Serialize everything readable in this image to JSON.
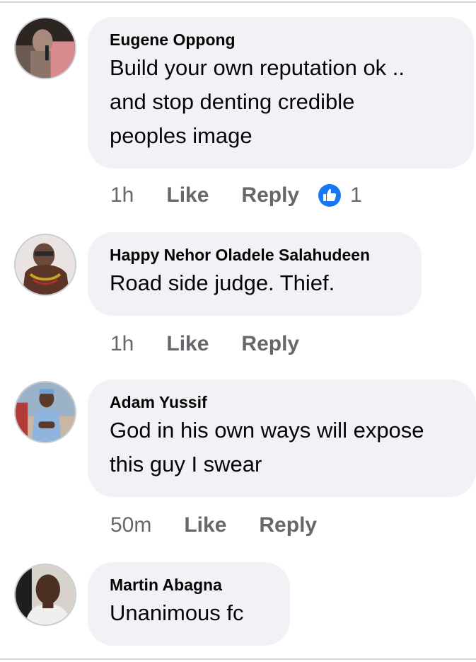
{
  "comments": [
    {
      "author": "Eugene Oppong",
      "lines": [
        "Build your own reputation ok ..",
        "and stop denting credible",
        "peoples image"
      ],
      "time": "1h",
      "like_label": "Like",
      "reply_label": "Reply",
      "reaction_count": "1",
      "reaction_icon": "thumbs-up-icon",
      "reaction_color": "#1877f2"
    },
    {
      "author": "Happy Nehor Oladele Salahudeen",
      "lines": [
        "Road side judge. Thief."
      ],
      "time": "1h",
      "like_label": "Like",
      "reply_label": "Reply"
    },
    {
      "author": "Adam Yussif",
      "lines": [
        "God in his own ways will expose",
        "this guy I swear"
      ],
      "time": "50m",
      "like_label": "Like",
      "reply_label": "Reply"
    },
    {
      "author": "Martin Abagna",
      "lines": [
        "Unanimous fc"
      ]
    }
  ],
  "colors": {
    "bubble_bg": "#f0f2f5",
    "meta_text": "#65676b",
    "primary_text": "#050505",
    "divider": "#d6d6d6"
  }
}
